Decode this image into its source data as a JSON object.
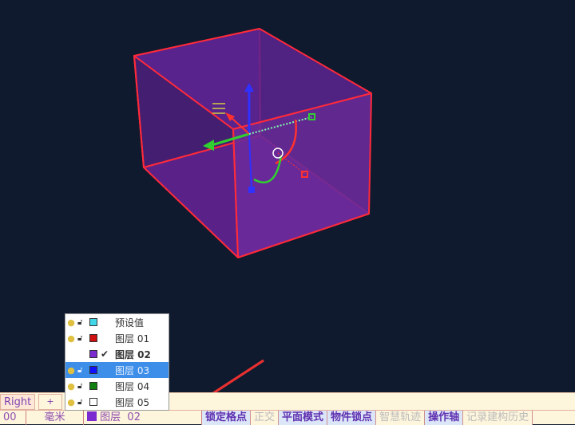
{
  "viewport": {
    "box_color": "#6a2a9a",
    "edge_color": "#ff3030"
  },
  "tabs": {
    "view_tab": "Right",
    "add_tab": "+"
  },
  "status": {
    "coord": "00",
    "unit": "毫米",
    "layer_label": "图层",
    "layer_num": "02",
    "layer_color": "#7a2ad0",
    "buttons": [
      {
        "label": "锁定格点",
        "on": true
      },
      {
        "label": "正交",
        "on": false
      },
      {
        "label": "平面模式",
        "on": true
      },
      {
        "label": "物件锁点",
        "on": true
      },
      {
        "label": "智慧轨迹",
        "on": false
      },
      {
        "label": "操作轴",
        "on": true
      },
      {
        "label": "记录建构历史",
        "on": false
      }
    ]
  },
  "layers": [
    {
      "name": "预设值",
      "color": "#40d8e8",
      "bulb": true,
      "lock": true,
      "current": false,
      "selected": false
    },
    {
      "name": "图层 01",
      "color": "#d01010",
      "bulb": true,
      "lock": true,
      "current": false,
      "selected": false
    },
    {
      "name": "图层 02",
      "color": "#7a2ad0",
      "bulb": false,
      "lock": false,
      "current": true,
      "selected": false
    },
    {
      "name": "图层 03",
      "color": "#1010ff",
      "bulb": true,
      "lock": true,
      "current": false,
      "selected": true
    },
    {
      "name": "图层 04",
      "color": "#108010",
      "bulb": true,
      "lock": true,
      "current": false,
      "selected": false
    },
    {
      "name": "图层 05",
      "color": "#ffffff",
      "bulb": true,
      "lock": true,
      "current": false,
      "selected": false
    }
  ],
  "icons": {
    "bulb": "💡",
    "lock": "🔓",
    "check": "✔"
  }
}
